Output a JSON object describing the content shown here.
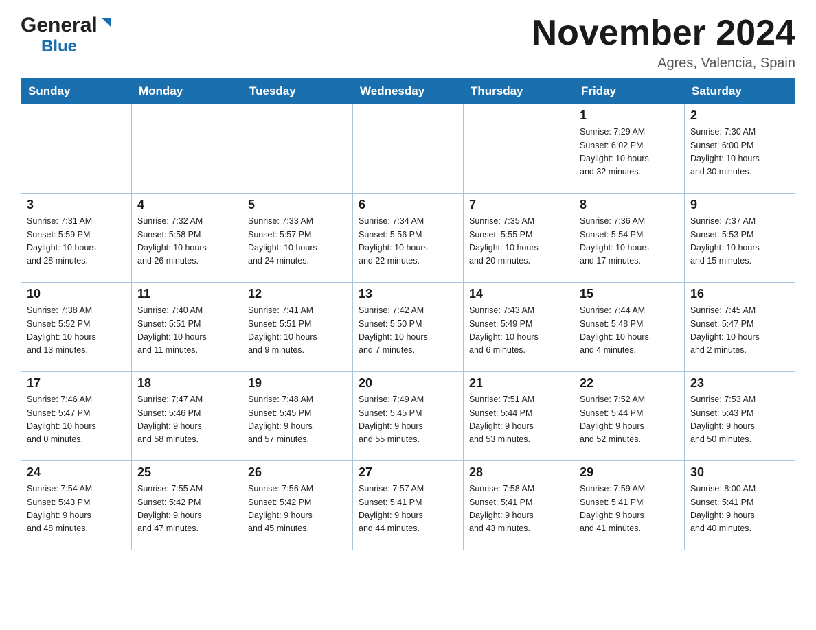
{
  "header": {
    "logo_general": "General",
    "logo_blue": "Blue",
    "month_title": "November 2024",
    "location": "Agres, Valencia, Spain"
  },
  "weekdays": [
    "Sunday",
    "Monday",
    "Tuesday",
    "Wednesday",
    "Thursday",
    "Friday",
    "Saturday"
  ],
  "weeks": [
    [
      {
        "day": "",
        "info": ""
      },
      {
        "day": "",
        "info": ""
      },
      {
        "day": "",
        "info": ""
      },
      {
        "day": "",
        "info": ""
      },
      {
        "day": "",
        "info": ""
      },
      {
        "day": "1",
        "info": "Sunrise: 7:29 AM\nSunset: 6:02 PM\nDaylight: 10 hours\nand 32 minutes."
      },
      {
        "day": "2",
        "info": "Sunrise: 7:30 AM\nSunset: 6:00 PM\nDaylight: 10 hours\nand 30 minutes."
      }
    ],
    [
      {
        "day": "3",
        "info": "Sunrise: 7:31 AM\nSunset: 5:59 PM\nDaylight: 10 hours\nand 28 minutes."
      },
      {
        "day": "4",
        "info": "Sunrise: 7:32 AM\nSunset: 5:58 PM\nDaylight: 10 hours\nand 26 minutes."
      },
      {
        "day": "5",
        "info": "Sunrise: 7:33 AM\nSunset: 5:57 PM\nDaylight: 10 hours\nand 24 minutes."
      },
      {
        "day": "6",
        "info": "Sunrise: 7:34 AM\nSunset: 5:56 PM\nDaylight: 10 hours\nand 22 minutes."
      },
      {
        "day": "7",
        "info": "Sunrise: 7:35 AM\nSunset: 5:55 PM\nDaylight: 10 hours\nand 20 minutes."
      },
      {
        "day": "8",
        "info": "Sunrise: 7:36 AM\nSunset: 5:54 PM\nDaylight: 10 hours\nand 17 minutes."
      },
      {
        "day": "9",
        "info": "Sunrise: 7:37 AM\nSunset: 5:53 PM\nDaylight: 10 hours\nand 15 minutes."
      }
    ],
    [
      {
        "day": "10",
        "info": "Sunrise: 7:38 AM\nSunset: 5:52 PM\nDaylight: 10 hours\nand 13 minutes."
      },
      {
        "day": "11",
        "info": "Sunrise: 7:40 AM\nSunset: 5:51 PM\nDaylight: 10 hours\nand 11 minutes."
      },
      {
        "day": "12",
        "info": "Sunrise: 7:41 AM\nSunset: 5:51 PM\nDaylight: 10 hours\nand 9 minutes."
      },
      {
        "day": "13",
        "info": "Sunrise: 7:42 AM\nSunset: 5:50 PM\nDaylight: 10 hours\nand 7 minutes."
      },
      {
        "day": "14",
        "info": "Sunrise: 7:43 AM\nSunset: 5:49 PM\nDaylight: 10 hours\nand 6 minutes."
      },
      {
        "day": "15",
        "info": "Sunrise: 7:44 AM\nSunset: 5:48 PM\nDaylight: 10 hours\nand 4 minutes."
      },
      {
        "day": "16",
        "info": "Sunrise: 7:45 AM\nSunset: 5:47 PM\nDaylight: 10 hours\nand 2 minutes."
      }
    ],
    [
      {
        "day": "17",
        "info": "Sunrise: 7:46 AM\nSunset: 5:47 PM\nDaylight: 10 hours\nand 0 minutes."
      },
      {
        "day": "18",
        "info": "Sunrise: 7:47 AM\nSunset: 5:46 PM\nDaylight: 9 hours\nand 58 minutes."
      },
      {
        "day": "19",
        "info": "Sunrise: 7:48 AM\nSunset: 5:45 PM\nDaylight: 9 hours\nand 57 minutes."
      },
      {
        "day": "20",
        "info": "Sunrise: 7:49 AM\nSunset: 5:45 PM\nDaylight: 9 hours\nand 55 minutes."
      },
      {
        "day": "21",
        "info": "Sunrise: 7:51 AM\nSunset: 5:44 PM\nDaylight: 9 hours\nand 53 minutes."
      },
      {
        "day": "22",
        "info": "Sunrise: 7:52 AM\nSunset: 5:44 PM\nDaylight: 9 hours\nand 52 minutes."
      },
      {
        "day": "23",
        "info": "Sunrise: 7:53 AM\nSunset: 5:43 PM\nDaylight: 9 hours\nand 50 minutes."
      }
    ],
    [
      {
        "day": "24",
        "info": "Sunrise: 7:54 AM\nSunset: 5:43 PM\nDaylight: 9 hours\nand 48 minutes."
      },
      {
        "day": "25",
        "info": "Sunrise: 7:55 AM\nSunset: 5:42 PM\nDaylight: 9 hours\nand 47 minutes."
      },
      {
        "day": "26",
        "info": "Sunrise: 7:56 AM\nSunset: 5:42 PM\nDaylight: 9 hours\nand 45 minutes."
      },
      {
        "day": "27",
        "info": "Sunrise: 7:57 AM\nSunset: 5:41 PM\nDaylight: 9 hours\nand 44 minutes."
      },
      {
        "day": "28",
        "info": "Sunrise: 7:58 AM\nSunset: 5:41 PM\nDaylight: 9 hours\nand 43 minutes."
      },
      {
        "day": "29",
        "info": "Sunrise: 7:59 AM\nSunset: 5:41 PM\nDaylight: 9 hours\nand 41 minutes."
      },
      {
        "day": "30",
        "info": "Sunrise: 8:00 AM\nSunset: 5:41 PM\nDaylight: 9 hours\nand 40 minutes."
      }
    ]
  ]
}
